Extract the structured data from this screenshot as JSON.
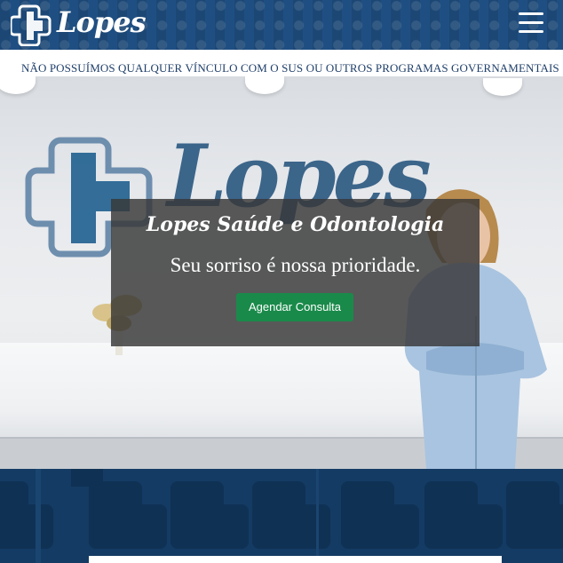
{
  "header": {
    "logo_text": "Lopes",
    "menu_icon": "hamburger-menu-icon"
  },
  "notice": {
    "text": "NÃO POSSUÍMOS QUALQUER VÍNCULO COM O SUS OU OUTROS PROGRAMAS GOVERNAMENTAIS"
  },
  "hero": {
    "wall_sign_text": "Lopes",
    "title": "Lopes Saúde e Odontologia",
    "subtitle": "Seu sorriso é nossa prioridade.",
    "cta_label": "Agendar Consulta"
  },
  "colors": {
    "brand_blue": "#1f4f82",
    "dark_blue": "#143b63",
    "cta_green": "#1a8a4a",
    "notice_text": "#1f3f6a"
  }
}
